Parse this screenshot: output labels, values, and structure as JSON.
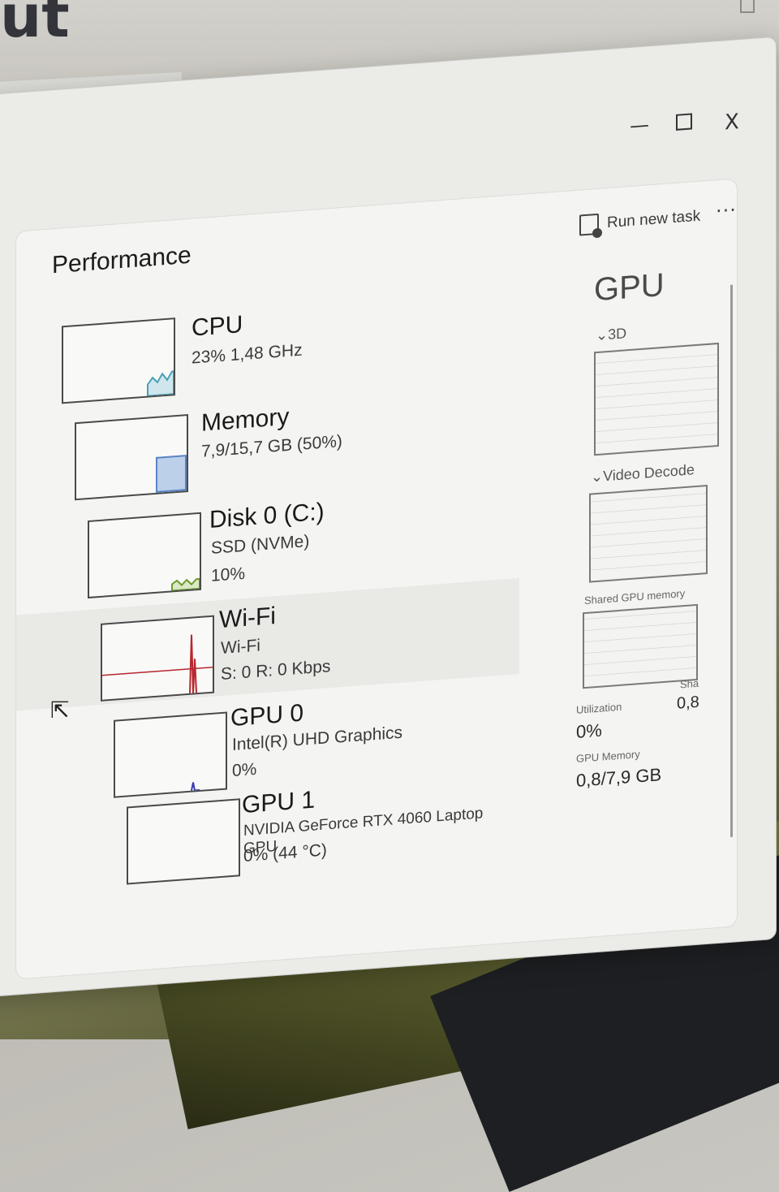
{
  "background": {
    "heading_fragment": "ut"
  },
  "window": {
    "minimize": "—",
    "close": "X"
  },
  "header": {
    "title": "Performance",
    "run_new_task": "Run new task",
    "more": "···"
  },
  "devices": [
    {
      "name": "CPU",
      "line1": "23% 1,48 GHz",
      "line2": "",
      "line3": "",
      "graph_color": "#4a9fb7",
      "graph_fill": "#cfe6ec"
    },
    {
      "name": "Memory",
      "line1": "7,9/15,7 GB (50%)",
      "line2": "",
      "line3": "",
      "graph_color": "#5b84c4",
      "graph_fill": "#bcd0ea"
    },
    {
      "name": "Disk 0 (C:)",
      "line1": "SSD (NVMe)",
      "line2": "10%",
      "line3": "",
      "graph_color": "#6c9a2e",
      "graph_fill": "#dbe9c5"
    },
    {
      "name": "Wi-Fi",
      "line1": "Wi-Fi",
      "line2": "S: 0 R: 0 Kbps",
      "line3": "",
      "graph_color": "#b7262d",
      "graph_fill": "#f3f3f1"
    },
    {
      "name": "GPU 0",
      "line1": "Intel(R) UHD Graphics",
      "line2": "0%",
      "line3": "",
      "graph_color": "#3a3ab0",
      "graph_fill": "#f3f3f1"
    },
    {
      "name": "GPU 1",
      "line1": "NVIDIA GeForce RTX 4060 Laptop GPU",
      "line2": "0% (44 °C)",
      "line3": "",
      "graph_color": "#3a3ab0",
      "graph_fill": "#f3f3f1"
    }
  ],
  "gpu_detail": {
    "title": "GPU",
    "engine1": "⌄3D",
    "engine2": "⌄Video Decode",
    "shared_memory_label": "Shared GPU memory",
    "utilization_label": "Utilization",
    "utilization_value": "0%",
    "gpu_memory_label": "GPU Memory",
    "gpu_memory_value": "0,8/7,9 GB",
    "shared_short_label": "Sha",
    "shared_short_value": "0,8"
  }
}
